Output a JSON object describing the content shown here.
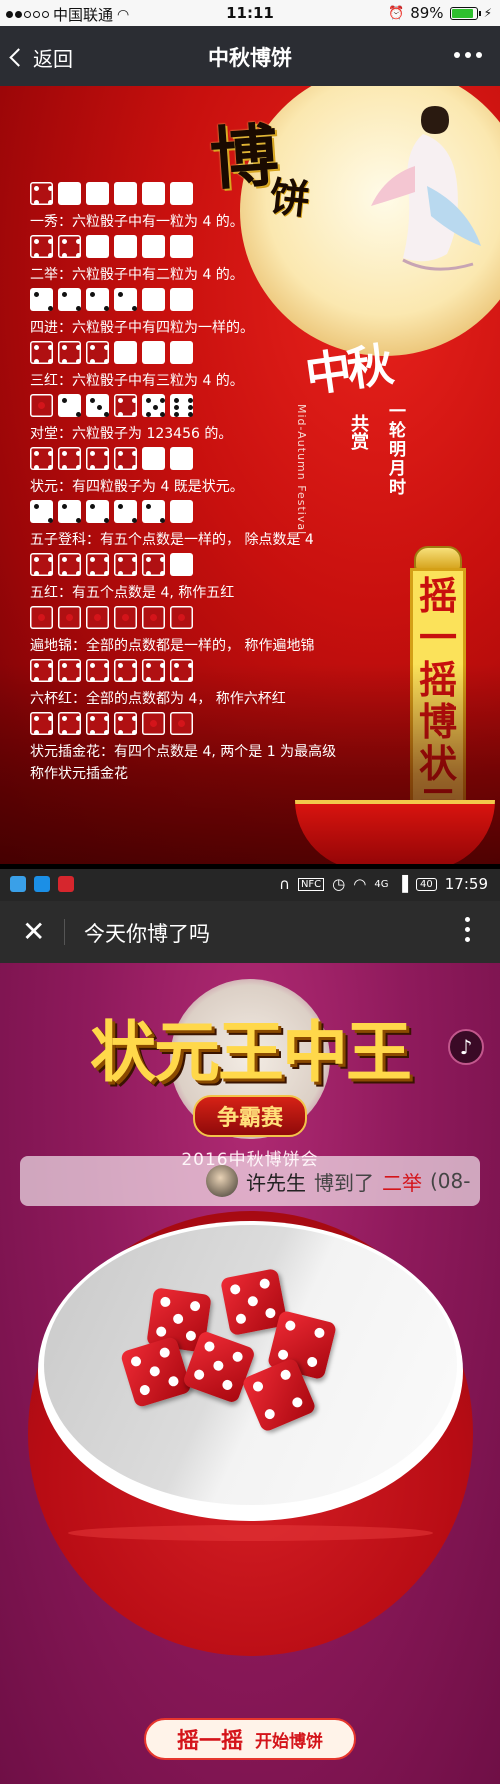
{
  "screen1": {
    "status": {
      "carrier": "中国联通",
      "time": "11:11",
      "battery": "89%",
      "battery_level": 0.89
    },
    "nav": {
      "back_label": "返回",
      "title": "中秋博饼"
    },
    "poster": {
      "title_big": "博",
      "title_small": "饼",
      "festival_title": "中秋",
      "festival_en": "Mid-Autumn Festival",
      "gongshang": "共赏",
      "yilun": "一轮明月时",
      "banner": [
        "摇",
        "一",
        "摇",
        "博",
        "状",
        "元"
      ]
    },
    "rules": [
      {
        "text": "一秀：六粒骰子中有一粒为 4 的。",
        "dice": [
          4,
          0,
          0,
          0,
          0,
          0
        ]
      },
      {
        "text": "二举：六粒骰子中有二粒为 4 的。",
        "dice": [
          4,
          4,
          0,
          0,
          0,
          0
        ]
      },
      {
        "text": "四进：六粒骰子中有四粒为一样的。",
        "dice": [
          2,
          2,
          2,
          2,
          0,
          0
        ]
      },
      {
        "text": "三红：六粒骰子中有三粒为 4 的。",
        "dice": [
          4,
          4,
          4,
          0,
          0,
          0
        ]
      },
      {
        "text": "对堂：六粒骰子为 123456 的。",
        "dice": [
          1,
          2,
          3,
          4,
          5,
          6
        ]
      },
      {
        "text": "状元：有四粒骰子为 4 既是状元。",
        "dice": [
          4,
          4,
          4,
          4,
          0,
          0
        ]
      },
      {
        "text": "五子登科：有五个点数是一样的， 除点数是 4",
        "dice": [
          2,
          2,
          2,
          2,
          2,
          0
        ]
      },
      {
        "text": "五红：有五个点数是 4, 称作五红",
        "dice": [
          4,
          4,
          4,
          4,
          4,
          0
        ]
      },
      {
        "text": "遍地锦：全部的点数都是一样的， 称作遍地锦",
        "dice": [
          1,
          1,
          1,
          1,
          1,
          1
        ]
      },
      {
        "text": "六杯红：全部的点数都为 4， 称作六杯红",
        "dice": [
          4,
          4,
          4,
          4,
          4,
          4
        ]
      },
      {
        "text": "状元插金花：有四个点数是 4, 两个是 1 为最高级",
        "text2": "称作状元插金花",
        "dice": [
          4,
          4,
          4,
          4,
          1,
          1
        ]
      }
    ]
  },
  "screen2": {
    "status": {
      "time": "17:59",
      "battery": "40",
      "network": "4G"
    },
    "nav": {
      "title": "今天你博了吗"
    },
    "hero": {
      "title": "状元王中王",
      "badge": "争霸赛",
      "subtitle": "2016中秋博饼会"
    },
    "ticker": {
      "name": "许先生",
      "action": "博到了",
      "result": "二举",
      "when": "(08-"
    },
    "bowl_dice": [
      {
        "value": 5
      },
      {
        "value": 5
      },
      {
        "value": 4
      },
      {
        "value": 5
      },
      {
        "value": 5
      },
      {
        "value": 4
      }
    ],
    "shake_button": {
      "label_a": "摇一摇",
      "label_b": "开始博饼"
    },
    "colors": {
      "accent": "#d4141a",
      "bg": "#8e1b5e",
      "gold": "#ffd84a"
    }
  }
}
